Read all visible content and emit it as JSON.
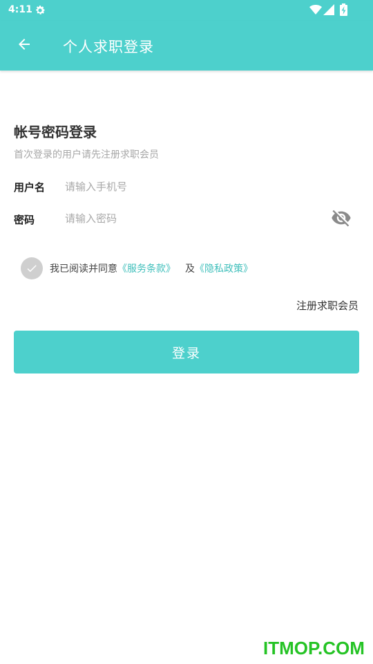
{
  "status_bar": {
    "time": "4:11",
    "icons": [
      "gear-icon",
      "wifi-icon",
      "signal-icon",
      "battery-charging-icon"
    ]
  },
  "app_bar": {
    "back_icon": "arrow-left-icon",
    "title": "个人求职登录"
  },
  "form": {
    "title": "帐号密码登录",
    "subtitle": "首次登录的用户请先注册求职会员",
    "username": {
      "label": "用户名",
      "value": "",
      "placeholder": "请输入手机号"
    },
    "password": {
      "label": "密码",
      "value": "",
      "placeholder": "请输入密码",
      "toggle_icon": "eye-off-icon"
    },
    "agreement": {
      "checked": true,
      "prefix": "我已阅读并同意",
      "terms_link": "《服务条款》",
      "and": "及",
      "privacy_link": "《隐私政策》"
    },
    "register_link": "注册求职会员",
    "login_button": "登录"
  },
  "watermark": "ITMOP.COM",
  "colors": {
    "primary": "#4dd0cc",
    "link": "#3fbfbb",
    "check_bg": "#cfcfcf",
    "watermark": "#25c325"
  }
}
